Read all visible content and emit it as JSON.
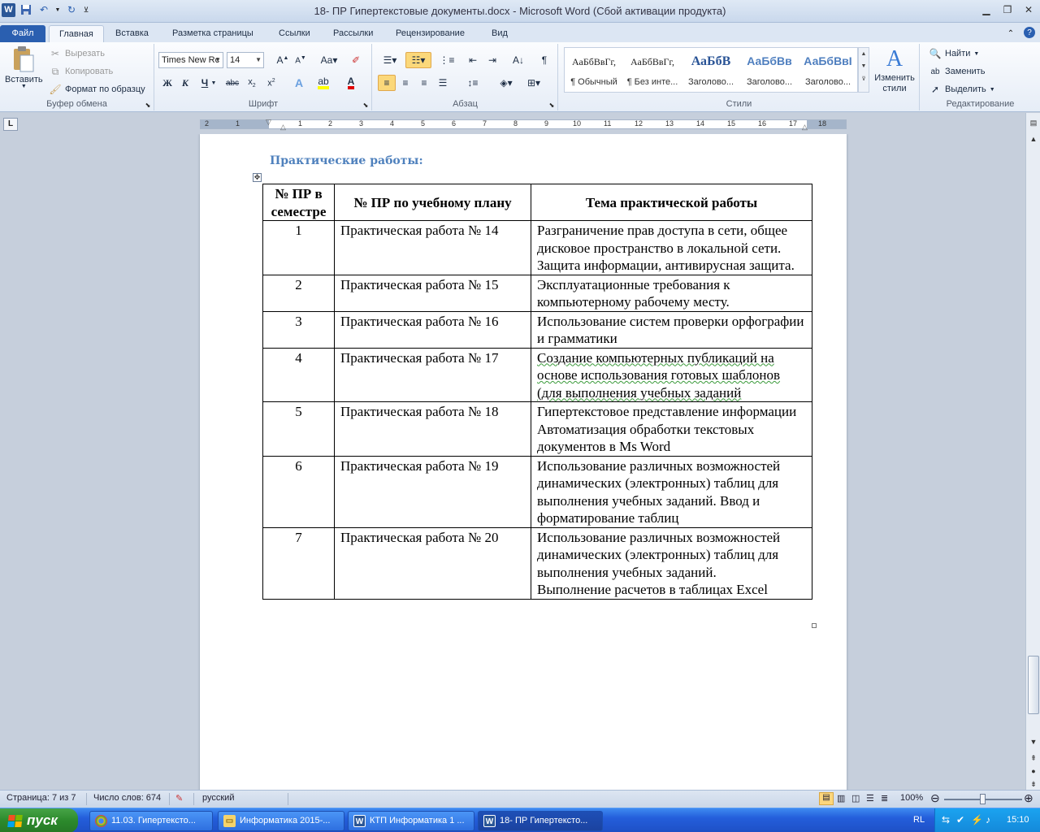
{
  "window": {
    "title": "18- ПР Гипертекстовые документы.docx  -  Microsoft Word (Сбой активации продукта)"
  },
  "tabs": [
    {
      "label": "Файл"
    },
    {
      "label": "Главная"
    },
    {
      "label": "Вставка"
    },
    {
      "label": "Разметка страницы"
    },
    {
      "label": "Ссылки"
    },
    {
      "label": "Рассылки"
    },
    {
      "label": "Рецензирование"
    },
    {
      "label": "Вид"
    }
  ],
  "ribbon": {
    "clipboard": {
      "label": "Буфер обмена",
      "paste": "Вставить",
      "cut": "Вырезать",
      "copy": "Копировать",
      "format_painter": "Формат по образцу"
    },
    "font": {
      "label": "Шрифт",
      "font_name": "Times New Rc",
      "font_size": "14"
    },
    "paragraph": {
      "label": "Абзац"
    },
    "styles": {
      "label": "Стили",
      "items": [
        {
          "sample": "АаБбВвГг,",
          "name": "¶ Обычный"
        },
        {
          "sample": "АаБбВвГг,",
          "name": "¶ Без инте..."
        },
        {
          "sample": "АаБбВ",
          "name": "Заголово..."
        },
        {
          "sample": "АаБбВв",
          "name": "Заголово..."
        },
        {
          "sample": "АаБбВвІ",
          "name": "Заголово..."
        }
      ],
      "change_styles": "Изменить стили"
    },
    "editing": {
      "label": "Редактирование",
      "find": "Найти",
      "replace": "Заменить",
      "select": "Выделить"
    }
  },
  "ruler": {
    "numbers": [
      "2",
      "1",
      "1",
      "1",
      "2",
      "3",
      "4",
      "5",
      "6",
      "7",
      "8",
      "9",
      "10",
      "11",
      "12",
      "13",
      "14",
      "15",
      "16",
      "17",
      "18"
    ]
  },
  "document": {
    "heading": "Практические работы:",
    "table": {
      "headers": [
        "№ ПР в семестре",
        "№ ПР по учебному плану",
        "Тема практической работы"
      ],
      "rows": [
        {
          "num": "1",
          "plan": "Практическая работа № 14",
          "topic": "Разграничение прав доступа в сети, общее дисковое пространство в локальной сети. Защита информации, антивирусная защита."
        },
        {
          "num": "2",
          "plan": "Практическая работа № 15",
          "topic": "Эксплуатационные требования к компьютерному рабочему месту."
        },
        {
          "num": "3",
          "plan": "Практическая работа № 16",
          "topic": "Использование систем проверки орфографии и грамматики"
        },
        {
          "num": "4",
          "plan": "Практическая работа № 17",
          "topic": "Создание компьютерных публикаций на основе использования готовых шаблонов (для выполнения учебных заданий"
        },
        {
          "num": "5",
          "plan": "Практическая работа № 18",
          "topic": "Гипертекстовое представление информации",
          "topic2": "Автоматизация обработки текстовых документов в Ms Word"
        },
        {
          "num": "6",
          "plan": "Практическая работа № 19",
          "topic": "Использование различных возможностей динамических (электронных) таблиц для выполнения учебных заданий. Ввод и форматирование таблиц"
        },
        {
          "num": "7",
          "plan": "Практическая работа № 20",
          "topic": "Использование различных возможностей динамических (электронных) таблиц для выполнения учебных заданий.",
          "topic2": "Выполнение расчетов в таблицах Excel"
        }
      ]
    }
  },
  "status": {
    "page": "Страница: 7 из 7",
    "words": "Число слов: 674",
    "language": "русский",
    "zoom": "100%"
  },
  "taskbar": {
    "start": "пуск",
    "tasks": [
      {
        "label": "11.03. Гипертексто..."
      },
      {
        "label": "Информатика 2015-..."
      },
      {
        "label": "КТП Информатика 1 ..."
      },
      {
        "label": "18- ПР Гипертексто..."
      }
    ],
    "lang": "RL",
    "time": "15:10"
  }
}
